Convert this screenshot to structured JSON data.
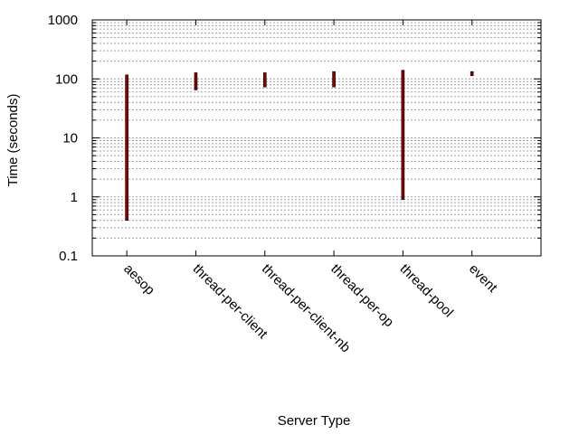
{
  "chart_data": {
    "type": "bar",
    "subtype": "range",
    "title": "",
    "xlabel": "Server Type",
    "ylabel": "Time (seconds)",
    "y_scale": "log",
    "ylim": [
      0.1,
      1000
    ],
    "y_ticks": [
      {
        "value": 0.1,
        "label": "0.1"
      },
      {
        "value": 1,
        "label": "1"
      },
      {
        "value": 10,
        "label": "10"
      },
      {
        "value": 100,
        "label": "100"
      },
      {
        "value": 1000,
        "label": "1000"
      }
    ],
    "grid": true,
    "legend": "none",
    "categories": [
      "aesop",
      "thread-per-client",
      "thread-per-client-nb",
      "thread-per-op",
      "thread-pool",
      "event"
    ],
    "series": [
      {
        "low": [
          0.4,
          65,
          73,
          73,
          0.9,
          113
        ],
        "high": [
          117,
          127,
          127,
          133,
          140,
          133
        ]
      }
    ],
    "colors": {
      "bar_fill": "#8b0000",
      "bar_edge": "#000000",
      "grid": "#a0a0a0",
      "axis": "#000000"
    }
  }
}
